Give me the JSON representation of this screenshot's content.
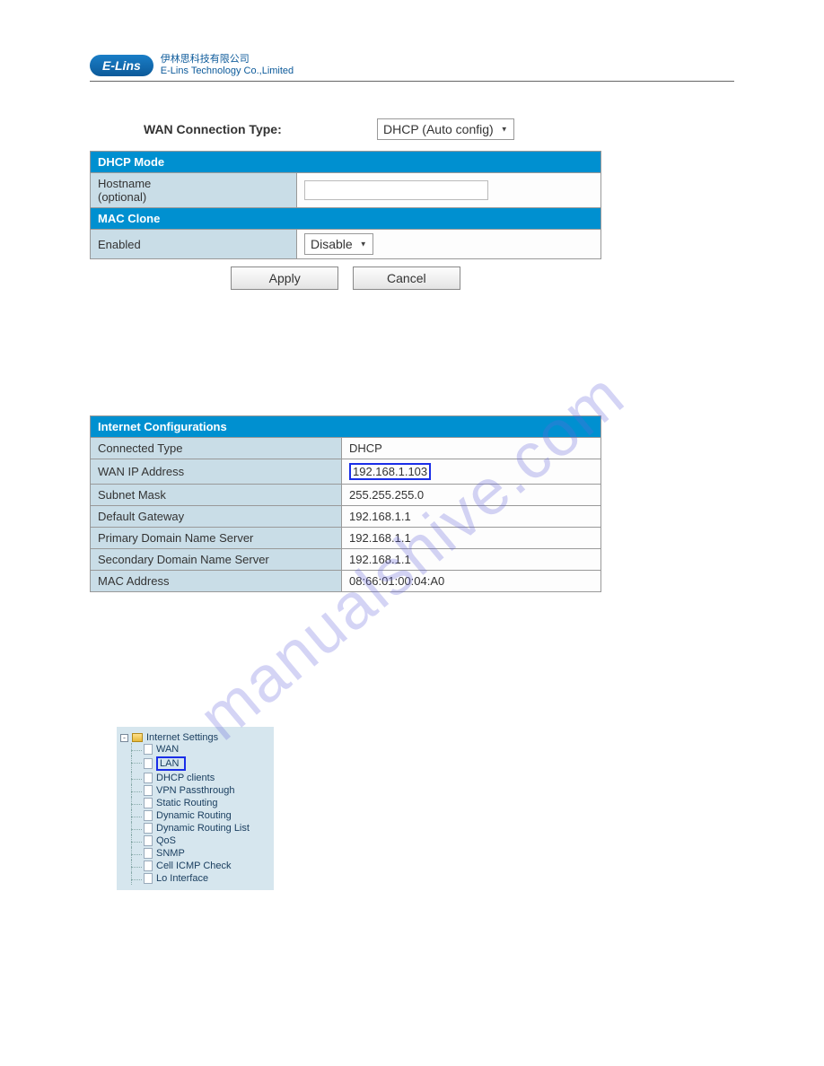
{
  "logo": {
    "brand": "E-Lins",
    "cn": "伊林思科技有限公司",
    "en": "E-Lins Technology Co.,Limited"
  },
  "wan": {
    "label": "WAN Connection Type:",
    "selected": "DHCP (Auto config)"
  },
  "dhcp_mode": {
    "header": "DHCP Mode",
    "hostname_label": "Hostname\n(optional)",
    "hostname_value": ""
  },
  "mac_clone": {
    "header": "MAC Clone",
    "enabled_label": "Enabled",
    "enabled_value": "Disable"
  },
  "buttons": {
    "apply": "Apply",
    "cancel": "Cancel"
  },
  "internet_config": {
    "header": "Internet Configurations",
    "rows": [
      {
        "k": "Connected Type",
        "v": "DHCP"
      },
      {
        "k": "WAN IP Address",
        "v": "192.168.1.103",
        "highlight": true
      },
      {
        "k": "Subnet Mask",
        "v": "255.255.255.0"
      },
      {
        "k": "Default Gateway",
        "v": "192.168.1.1"
      },
      {
        "k": "Primary Domain Name Server",
        "v": "192.168.1.1"
      },
      {
        "k": "Secondary Domain Name Server",
        "v": "192.168.1.1"
      },
      {
        "k": "MAC Address",
        "v": "08:66:01:00:04:A0"
      }
    ]
  },
  "tree": {
    "root": "Internet Settings",
    "items": [
      {
        "label": "WAN"
      },
      {
        "label": "LAN",
        "selected": true
      },
      {
        "label": "DHCP clients"
      },
      {
        "label": "VPN Passthrough"
      },
      {
        "label": "Static Routing"
      },
      {
        "label": "Dynamic Routing"
      },
      {
        "label": "Dynamic Routing List"
      },
      {
        "label": "QoS"
      },
      {
        "label": "SNMP"
      },
      {
        "label": "Cell ICMP Check"
      },
      {
        "label": "Lo Interface"
      }
    ]
  },
  "watermark": "manualshive.com"
}
